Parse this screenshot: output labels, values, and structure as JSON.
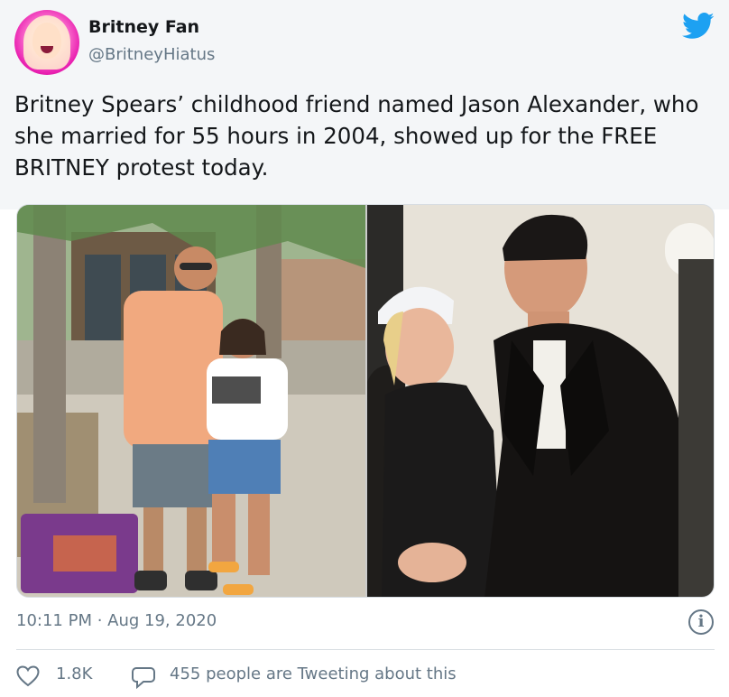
{
  "author": {
    "name": "Britney Fan",
    "handle": "@BritneyHiatus",
    "avatar_icon": "profile-avatar"
  },
  "brand_icon": "twitter-bird-icon",
  "tweet": {
    "text": "Britney Spears’ childhood friend named Jason Alexander, who she married for 55 hours in 2004, showed up for the FREE BRITNEY protest today."
  },
  "media": {
    "images": [
      {
        "icon": "photo-couple-street"
      },
      {
        "icon": "photo-couple-archive"
      }
    ]
  },
  "meta": {
    "timestamp": "10:11 PM · Aug 19, 2020",
    "info_icon": "info-icon"
  },
  "actions": {
    "likes": "1.8K",
    "tweeting": "455 people are Tweeting about this",
    "like_icon": "heart-icon",
    "reply_icon": "speech-bubble-icon"
  },
  "colors": {
    "twitter_blue": "#1DA1F2",
    "secondary_text": "#657786",
    "header_bg": "#f4f6f8"
  }
}
